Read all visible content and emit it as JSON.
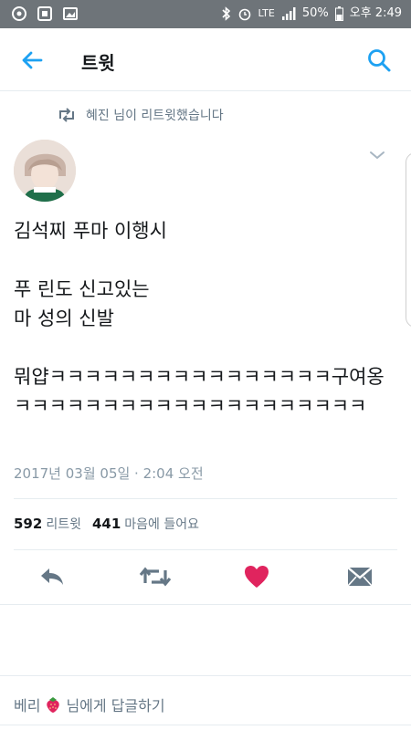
{
  "status_bar": {
    "network": "LTE",
    "battery": "50%",
    "time": "오후 2:49"
  },
  "header": {
    "title": "트윗"
  },
  "retweet_context": {
    "text": "혜진 님이 리트윗했습니다"
  },
  "tweet": {
    "text": "김석찌 푸마 이행시\n\n푸 린도 신고있는\n마 성의 신발\n\n뭐얍ㅋㅋㅋㅋㅋㅋㅋㅋㅋㅋㅋㅋㅋㅋㅋㅋ구여옹ㅋㅋㅋㅋㅋㅋㅋㅋㅋㅋㅋㅋㅋㅋㅋㅋㅋㅋㅋㅋ",
    "timestamp": "2017년 03월 05일 · 2:04 오전"
  },
  "stats": {
    "retweets_count": "592",
    "retweets_label": "리트윗",
    "likes_count": "441",
    "likes_label": "마음에 들어요"
  },
  "reply": {
    "placeholder_prefix": "베리",
    "placeholder_suffix": "님에게 답글하기"
  },
  "colors": {
    "accent": "#1da1f2",
    "like": "#e0245e",
    "status_bar": "#6e7479"
  }
}
